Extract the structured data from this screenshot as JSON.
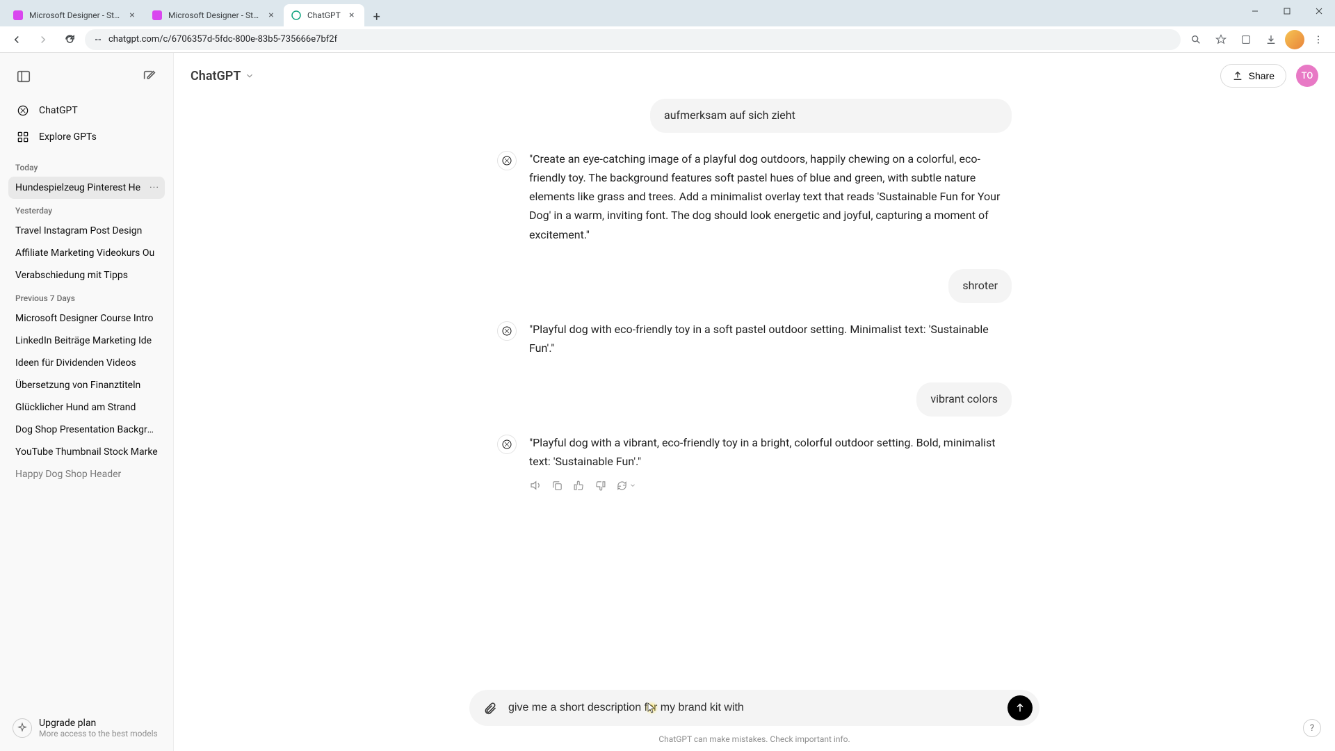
{
  "browser": {
    "tabs": [
      {
        "title": "Microsoft Designer - Stunning",
        "active": false
      },
      {
        "title": "Microsoft Designer - Stunning",
        "active": false
      },
      {
        "title": "ChatGPT",
        "active": true
      }
    ],
    "url": "chatgpt.com/c/6706357d-5fdc-800e-83b5-735666e7bf2f"
  },
  "sidebar": {
    "nav": {
      "chatgpt": "ChatGPT",
      "explore": "Explore GPTs"
    },
    "sections": [
      {
        "label": "Today",
        "items": [
          {
            "title": "Hundespielzeug Pinterest He",
            "active": true,
            "more": true
          }
        ]
      },
      {
        "label": "Yesterday",
        "items": [
          {
            "title": "Travel Instagram Post Design"
          },
          {
            "title": "Affiliate Marketing Videokurs Ou"
          },
          {
            "title": "Verabschiedung mit Tipps"
          }
        ]
      },
      {
        "label": "Previous 7 Days",
        "items": [
          {
            "title": "Microsoft Designer Course Intro"
          },
          {
            "title": "LinkedIn Beiträge Marketing Ide"
          },
          {
            "title": "Ideen für Dividenden Videos"
          },
          {
            "title": "Übersetzung von Finanztiteln"
          },
          {
            "title": "Glücklicher Hund am Strand"
          },
          {
            "title": "Dog Shop Presentation Backgrou"
          },
          {
            "title": "YouTube Thumbnail Stock Marke"
          },
          {
            "title": "Happy Dog Shop Header",
            "faded": true
          }
        ]
      }
    ],
    "upgrade": {
      "title": "Upgrade plan",
      "subtitle": "More access to the best models"
    }
  },
  "header": {
    "model": "ChatGPT",
    "share": "Share",
    "avatar": "TO"
  },
  "messages": {
    "u1": "aufmerksam auf sich zieht",
    "a1": "\"Create an eye-catching image of a playful dog outdoors, happily chewing on a colorful, eco-friendly toy. The background features soft pastel hues of blue and green, with subtle nature elements like grass and trees. Add a minimalist overlay text that reads 'Sustainable Fun for Your Dog' in a warm, inviting font. The dog should look energetic and joyful, capturing a moment of excitement.\"",
    "u2": "shroter",
    "a2": "\"Playful dog with eco-friendly toy in a soft pastel outdoor setting. Minimalist text: 'Sustainable Fun'.\"",
    "u3": "vibrant colors",
    "a3": "\"Playful dog with a vibrant, eco-friendly toy in a bright, colorful outdoor setting. Bold, minimalist text: 'Sustainable Fun'.\""
  },
  "composer": {
    "value": "give me a short description for my brand kit with",
    "placeholder": "Message ChatGPT"
  },
  "footer": "ChatGPT can make mistakes. Check important info.",
  "help": "?"
}
